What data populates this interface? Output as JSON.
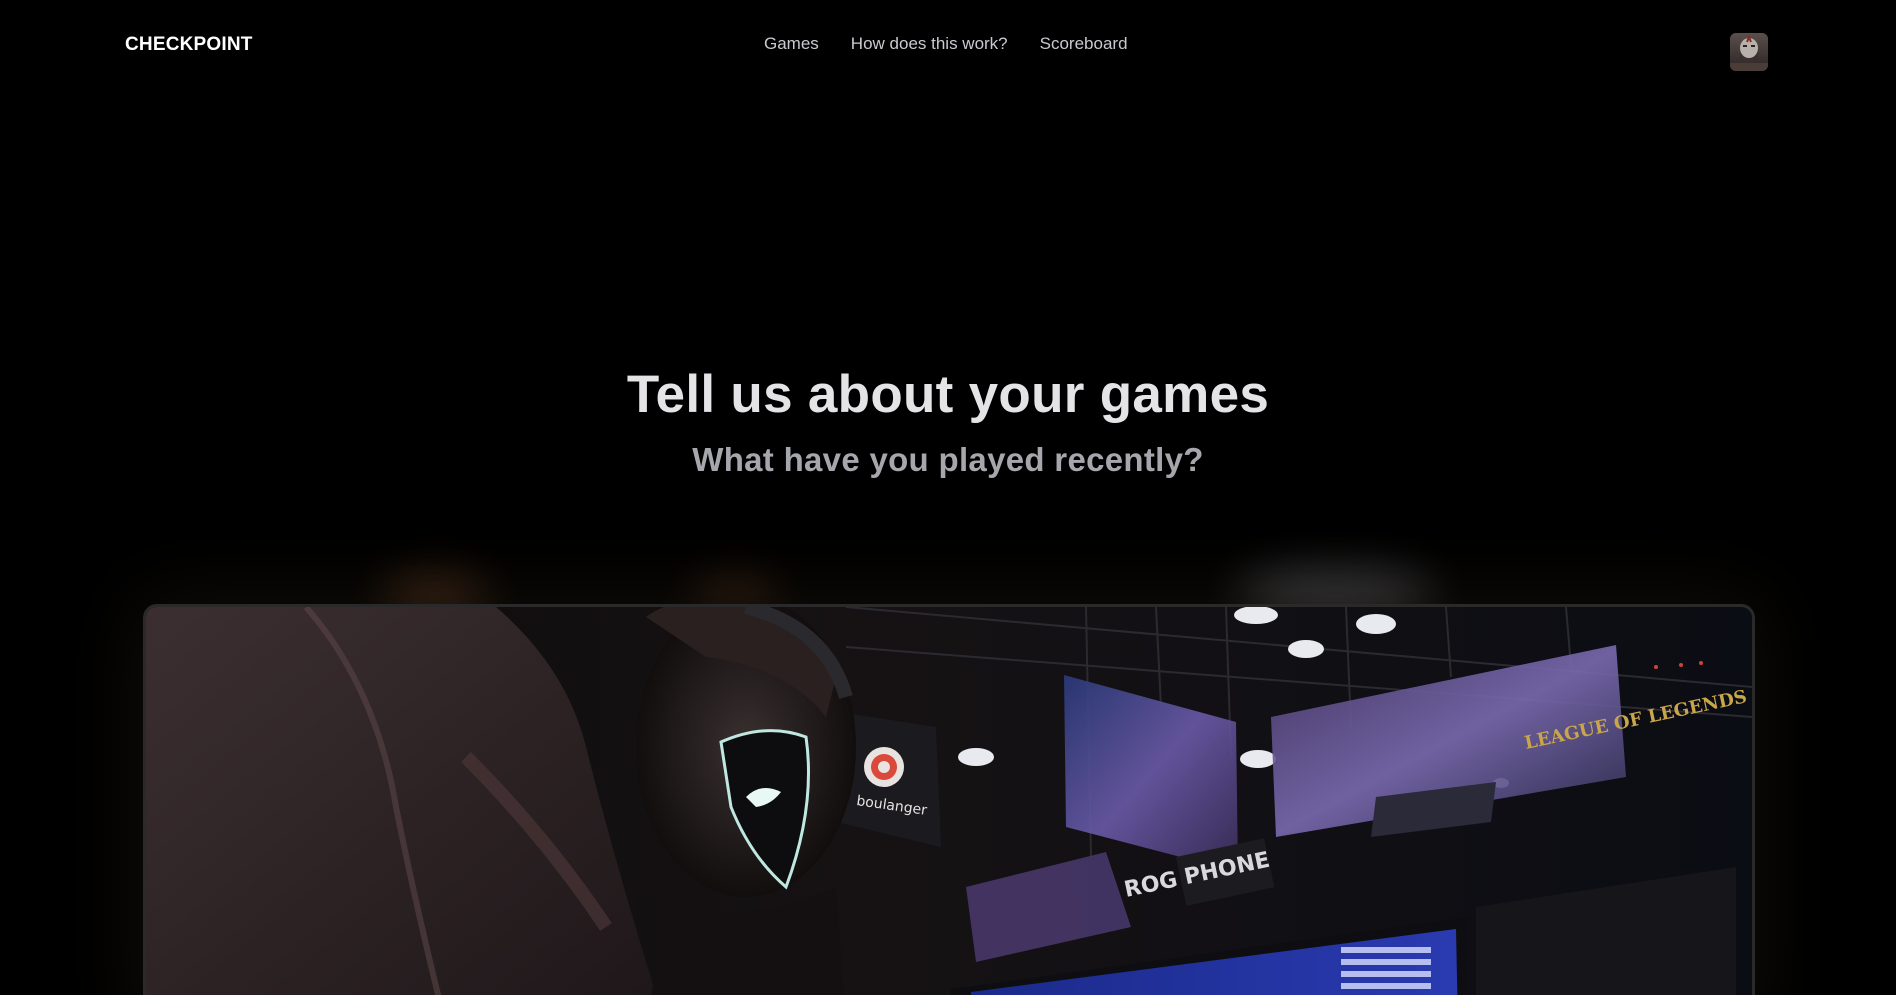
{
  "header": {
    "logo": "CHECKPOINT",
    "nav": [
      {
        "label": "Games"
      },
      {
        "label": "How does this work?"
      },
      {
        "label": "Scoreboard"
      }
    ]
  },
  "hero": {
    "title": "Tell us about your games",
    "subtitle": "What have you played recently?"
  },
  "image": {
    "banner_text": "LEAGUE OF LEGENDS",
    "sponsor_text": "boulanger",
    "stage_text": "ROG PHONE"
  },
  "colors": {
    "background": "#000000",
    "title": "#e4e4e7",
    "subtitle": "#a6a6ad",
    "nav": "#c9c9cf"
  }
}
